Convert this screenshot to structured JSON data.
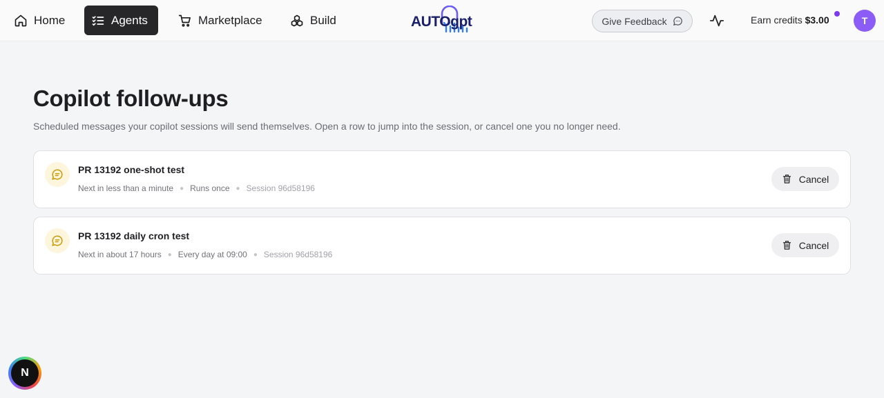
{
  "nav": {
    "items": [
      {
        "label": "Home",
        "icon": "home-icon"
      },
      {
        "label": "Agents",
        "icon": "list-checks-icon",
        "active": true
      },
      {
        "label": "Marketplace",
        "icon": "cart-icon"
      },
      {
        "label": "Build",
        "icon": "cubes-icon"
      }
    ]
  },
  "logo": {
    "text": "AUTOgpt"
  },
  "header": {
    "feedback_label": "Give Feedback",
    "credits_label": "Earn credits",
    "credits_amount": "$3.00",
    "avatar_initial": "T"
  },
  "page": {
    "title": "Copilot follow-ups",
    "subtitle": "Scheduled messages your copilot sessions will send themselves. Open a row to jump into the session, or cancel one you no longer need."
  },
  "followups": [
    {
      "title": "PR 13192 one-shot test",
      "next": "Next in less than a minute",
      "schedule": "Runs once",
      "session": "Session 96d58196",
      "cancel_label": "Cancel"
    },
    {
      "title": "PR 13192 daily cron test",
      "next": "Next in about 17 hours",
      "schedule": "Every day at 09:00",
      "session": "Session 96d58196",
      "cancel_label": "Cancel"
    }
  ],
  "fab": {
    "label": "N"
  },
  "colors": {
    "accent": "#8b5cf6",
    "active_nav": "#27272a",
    "icon_bg": "#fdf5dc",
    "icon_color": "#c99a06"
  }
}
